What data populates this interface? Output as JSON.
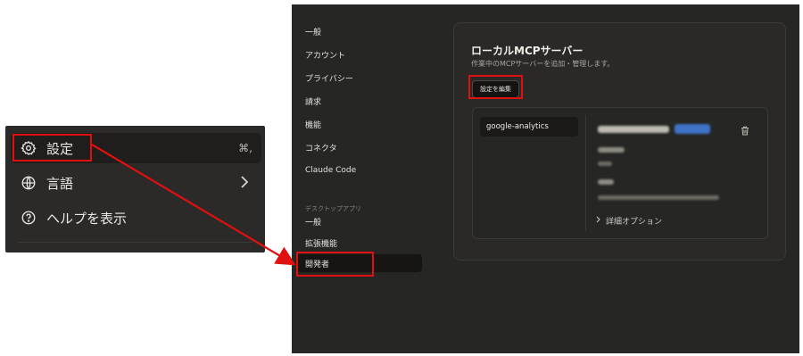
{
  "context_menu": {
    "items": [
      {
        "label": "設定",
        "shortcut": "⌘,",
        "icon": "gear-icon"
      },
      {
        "label": "言語",
        "icon": "globe-icon"
      },
      {
        "label": "ヘルプを表示",
        "icon": "help-circle-icon"
      }
    ]
  },
  "settings": {
    "nav": {
      "items": [
        "一般",
        "アカウント",
        "プライバシー",
        "請求",
        "機能",
        "コネクタ",
        "Claude Code"
      ],
      "section_label": "デスクトップアプリ",
      "desktop_items": [
        "一般",
        "拡張機能",
        "開発者"
      ]
    },
    "panel": {
      "title": "ローカルMCPサーバー",
      "subtitle": "作業中のMCPサーバーを追加・管理します。",
      "edit_button": "設定を編集",
      "servers": [
        "google-analytics"
      ],
      "advanced_options": "詳細オプション"
    }
  },
  "colors": {
    "highlight": "#e01010",
    "window_bg": "#262624",
    "menu_bg": "#2b2a28"
  }
}
